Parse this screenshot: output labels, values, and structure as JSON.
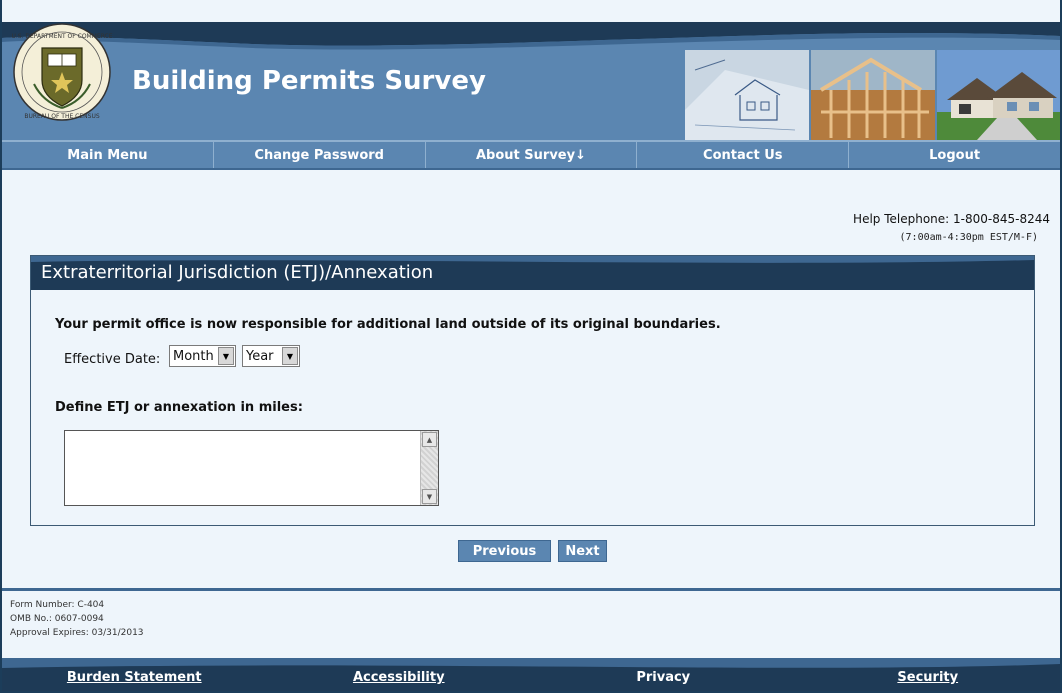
{
  "header": {
    "title": "Building Permits Survey",
    "seal_text_top": "U.S. DEPARTMENT OF COMMERCE",
    "seal_text_bottom": "BUREAU OF THE CENSUS"
  },
  "nav": {
    "items": [
      {
        "label": "Main Menu"
      },
      {
        "label": "Change Password"
      },
      {
        "label": "About Survey↓"
      },
      {
        "label": "Contact Us"
      },
      {
        "label": "Logout"
      }
    ]
  },
  "help": {
    "telephone": "Help Telephone: 1-800-845-8244",
    "hours": "(7:00am-4:30pm EST/M-F)"
  },
  "panel": {
    "title": "Extraterritorial Jurisdiction (ETJ)/Annexation",
    "question1": "Your permit office is now responsible for additional land outside of its original boundaries.",
    "effective_date_label": "Effective Date:",
    "month_value": "Month",
    "year_value": "Year",
    "question2": "Define ETJ or annexation in miles:",
    "textarea_value": ""
  },
  "buttons": {
    "previous": "Previous",
    "next": "Next"
  },
  "form_info": {
    "form_number": "Form Number: C-404",
    "omb": "OMB No.: 0607-0094",
    "approval": "Approval Expires: 03/31/2013"
  },
  "footer": {
    "links": [
      {
        "label": "Burden Statement"
      },
      {
        "label": "Accessibility"
      },
      {
        "label": "Privacy"
      },
      {
        "label": "Security"
      }
    ]
  },
  "colors": {
    "header_blue": "#5b86b1",
    "dark_navy": "#1e3a56",
    "page_bg": "#eef5fb"
  }
}
